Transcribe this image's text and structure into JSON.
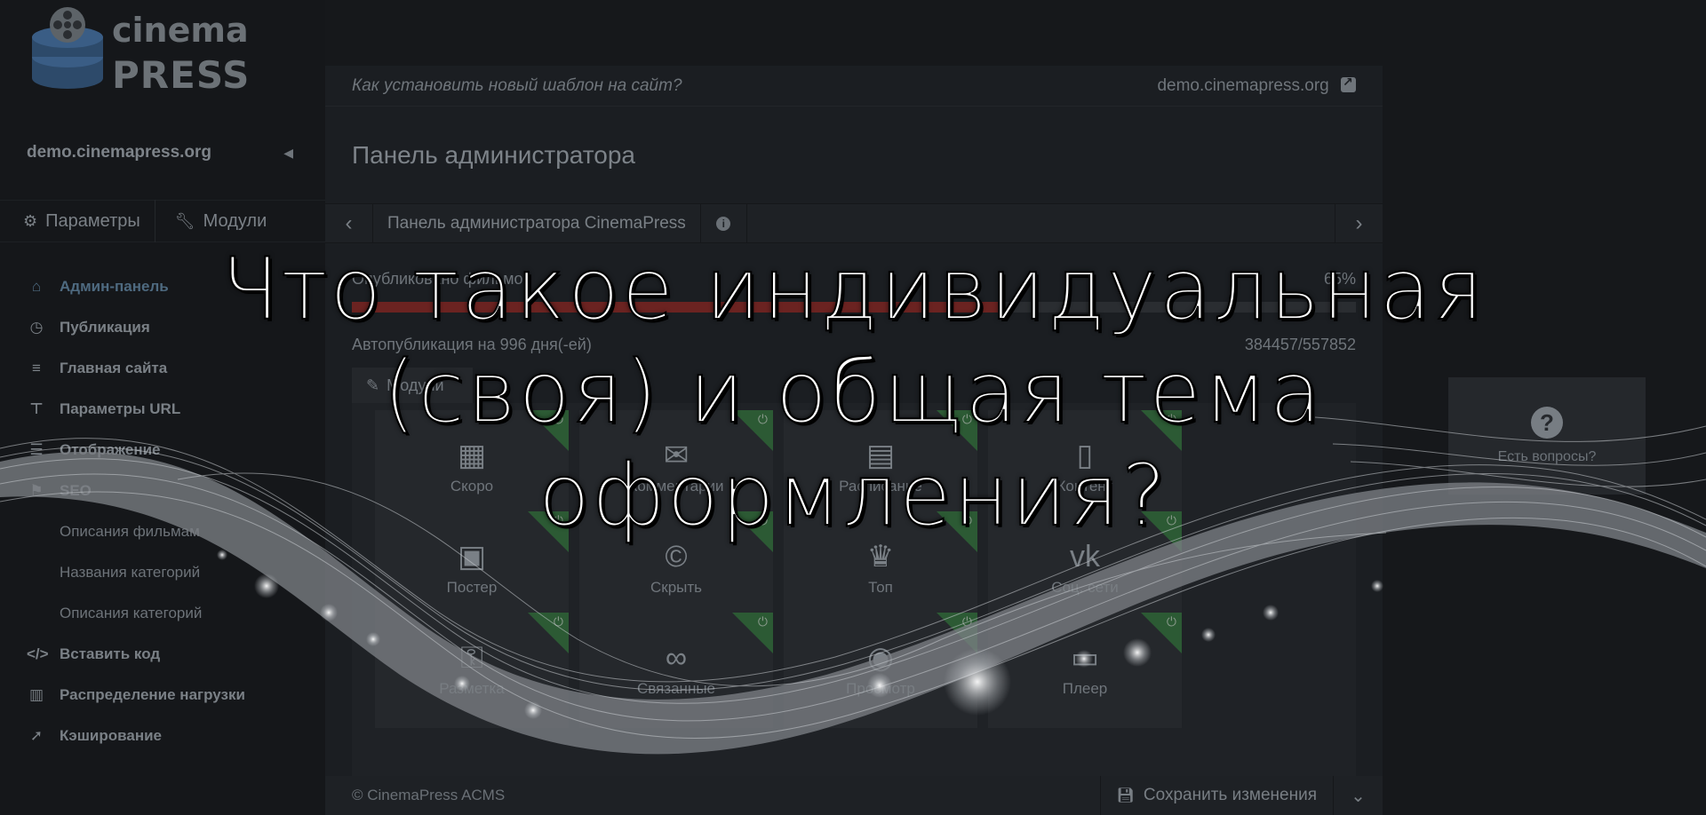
{
  "logo": {
    "line1": "cinema",
    "line2": "PRESS"
  },
  "sidebar": {
    "site": "demo.cinemapress.org",
    "tabs": [
      {
        "label": "Параметры",
        "icon": "gears-icon"
      },
      {
        "label": "Модули",
        "icon": "wrench-icon"
      }
    ],
    "menu": [
      {
        "label": "Админ-панель",
        "icon": "home-icon",
        "active": true
      },
      {
        "label": "Публикация",
        "icon": "clock-icon"
      },
      {
        "label": "Главная сайта",
        "icon": "bars-icon"
      },
      {
        "label": "Параметры URL",
        "icon": "sitemap-icon"
      },
      {
        "label": "Отображение",
        "icon": "list-icon"
      },
      {
        "label": "SEO",
        "icon": "seo-icon"
      }
    ],
    "submenu": [
      "Описания фильмам",
      "Названия категорий",
      "Описания категорий"
    ],
    "menu2": [
      {
        "label": "Вставить код",
        "icon": "code-icon"
      },
      {
        "label": "Распределение нагрузки",
        "icon": "bar-chart-icon"
      },
      {
        "label": "Кэширование",
        "icon": "rocket-icon"
      }
    ]
  },
  "main": {
    "topbar": {
      "question": "Как установить новый шаблон на сайт?",
      "site_link": "demo.cinemapress.org"
    },
    "title": "Панель администратора",
    "breadcrumb": "Панель администратора CinemaPress",
    "stats": {
      "published_label": "Опубликовано фильмов",
      "published_percent": "65%",
      "progress": 0.65,
      "autopub_label": "Автопубликация на 996 дня(-ей)",
      "autopub_value": "384457/557852"
    },
    "modules_tab": "Модули",
    "modules": [
      {
        "label": "Скоро",
        "icon": "calendar-icon",
        "glyph": "▦"
      },
      {
        "label": "Комментарии",
        "icon": "comments-icon",
        "glyph": "✉"
      },
      {
        "label": "Расписание",
        "icon": "list-alt-icon",
        "glyph": "▤"
      },
      {
        "label": "Контент",
        "icon": "file-icon",
        "glyph": "▯"
      },
      {
        "label": "Постер",
        "icon": "image-icon",
        "glyph": "▣"
      },
      {
        "label": "Скрыть",
        "icon": "copyright-icon",
        "glyph": "©"
      },
      {
        "label": "Топ",
        "icon": "trophy-icon",
        "glyph": "♛"
      },
      {
        "label": "Соц. сети",
        "icon": "vk-icon",
        "glyph": "vk"
      },
      {
        "label": "Разметка",
        "icon": "key-icon",
        "glyph": "⚿"
      },
      {
        "label": "Связанные",
        "icon": "link-icon",
        "glyph": "∞"
      },
      {
        "label": "Просмотр",
        "icon": "eye-icon",
        "glyph": "◉"
      },
      {
        "label": "Плеер",
        "icon": "monitor-icon",
        "glyph": "▭"
      }
    ],
    "footer": {
      "copyright": "© CinemaPress ACMS",
      "save_label": "Сохранить изменения"
    }
  },
  "help": {
    "label": "Есть вопросы?"
  },
  "headline": {
    "line1": "Что такое индивидуальная",
    "line2": "(своя) и общая тема",
    "line3": "оформления?"
  },
  "colors": {
    "accent_active": "#4e6a80",
    "progress_fill": "#6b2321",
    "module_corner": "#2c5a34"
  }
}
